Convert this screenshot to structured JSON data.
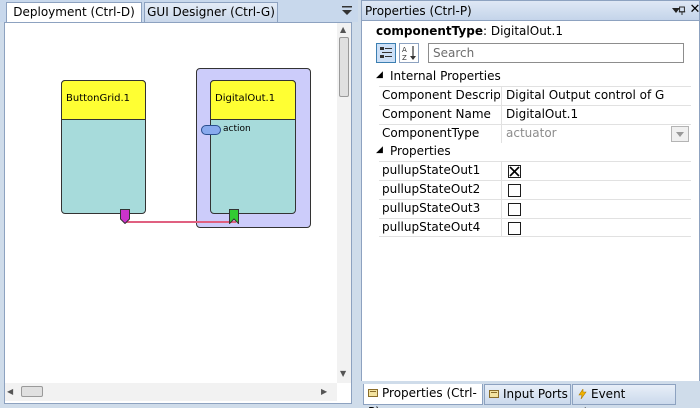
{
  "left_pane": {
    "tabs": [
      {
        "label": "Deployment (Ctrl-D)",
        "active": true
      },
      {
        "label": "GUI Designer (Ctrl-G)",
        "active": false
      }
    ],
    "components": [
      {
        "name": "ButtonGrid.1"
      },
      {
        "name": "DigitalOut.1",
        "port_label": "action"
      }
    ]
  },
  "properties": {
    "title": "Properties (Ctrl-P)",
    "component_type_key": "componentType",
    "component_type_value": "DigitalOut.1",
    "search_placeholder": "Search",
    "categories": [
      {
        "label": "Internal Properties",
        "rows": [
          {
            "name": "Component Descriptic",
            "value": "Digital Output control of GPIO-CIM"
          },
          {
            "name": "Component Name",
            "value": "DigitalOut.1"
          },
          {
            "name": "ComponentType",
            "value": "actuator"
          }
        ]
      },
      {
        "label": "Properties",
        "rows": [
          {
            "name": "pullupStateOut1",
            "checked": true
          },
          {
            "name": "pullupStateOut2",
            "checked": false
          },
          {
            "name": "pullupStateOut3",
            "checked": false
          },
          {
            "name": "pullupStateOut4",
            "checked": false
          }
        ]
      }
    ],
    "bottom_tabs": [
      {
        "label": "Properties (Ctrl-P)",
        "active": true
      },
      {
        "label": "Input Ports",
        "active": false
      },
      {
        "label": "Event Listener",
        "active": false
      }
    ]
  },
  "colors": {
    "component_header": "#ffff33",
    "component_body": "#a7dbdb",
    "selection_frame": "#ccccfa",
    "event_trigger_port": "#cc33cc",
    "event_listener_port": "#33cc33",
    "event_channel": "#e06080",
    "input_port": "#88aaee"
  }
}
